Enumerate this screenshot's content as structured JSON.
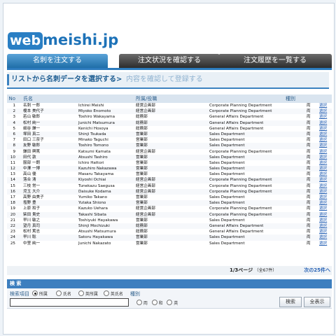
{
  "logo": {
    "web": "web",
    "rest": "meishi.jp"
  },
  "tabs": [
    {
      "label": "名刺を注文する",
      "active": true
    },
    {
      "label": "注文状況を確認する",
      "active": false
    },
    {
      "label": "注文履歴を一覧する",
      "active": false
    }
  ],
  "steps": {
    "current": "リストから名刺データを選択する",
    "arrow": ">",
    "next": "内容を確認して登録する"
  },
  "table": {
    "headers": {
      "no": "No",
      "name": "氏名",
      "dept": "所属/役職",
      "type": "種別"
    },
    "select_label": "選択",
    "rows": [
      {
        "no": "1",
        "name": "名刺 一郎",
        "roman": "Ichirei Meishi",
        "dept": "経営企画部",
        "eng": "Corporate Planning Department",
        "type": "両"
      },
      {
        "no": "2",
        "name": "榎本 美代子",
        "roman": "Miyoko Enomoto",
        "dept": "経営企画部",
        "eng": "Corporate Planning Department",
        "type": "両"
      },
      {
        "no": "3",
        "name": "若山 敏郎",
        "roman": "Toshiro Wakayama",
        "dept": "総務部",
        "eng": "General Affairs Department",
        "type": "両"
      },
      {
        "no": "4",
        "name": "松村 純一",
        "roman": "Junichi Matsumura",
        "dept": "総務部",
        "eng": "General Affairs Department",
        "type": "両"
      },
      {
        "no": "5",
        "name": "細谷 謙一",
        "roman": "Kenichi Hosoya",
        "dept": "総務部",
        "eng": "General Affairs Department",
        "type": "両"
      },
      {
        "no": "6",
        "name": "塚田 真二",
        "roman": "Shinji Tsukada",
        "dept": "営業部",
        "eng": "Sales Department",
        "type": "両"
      },
      {
        "no": "7",
        "name": "田口 三奈子",
        "roman": "Minako Taguchi",
        "dept": "営業部",
        "eng": "Sales Department",
        "type": "両"
      },
      {
        "no": "8",
        "name": "友野 敏郎",
        "roman": "Toshiro Tomono",
        "dept": "営業部",
        "eng": "Sales Department",
        "type": "両"
      },
      {
        "no": "9",
        "name": "鎌田 興篤",
        "roman": "Katsumi Kamata",
        "dept": "経営企画部",
        "eng": "Corporate Planning Department",
        "type": "両"
      },
      {
        "no": "10",
        "name": "田代 敦",
        "roman": "Atsushi Tashiro",
        "dept": "営業部",
        "eng": "Sales Department",
        "type": "両"
      },
      {
        "no": "11",
        "name": "服部 一朗",
        "roman": "Ichiro Hattori",
        "dept": "営業部",
        "eng": "Sales Department",
        "type": "両"
      },
      {
        "no": "12",
        "name": "中澤 一博",
        "roman": "Kazuhiro Nakazawa",
        "dept": "営業部",
        "eng": "Sales Department",
        "type": "両"
      },
      {
        "no": "13",
        "name": "高山 優",
        "roman": "Masaru Takayama",
        "dept": "営業部",
        "eng": "Sales Department",
        "type": "両"
      },
      {
        "no": "14",
        "name": "落合 清",
        "roman": "Kiyoshi Ochiai",
        "dept": "経営企画部",
        "eng": "Corporate Planning Department",
        "type": "両"
      },
      {
        "no": "15",
        "name": "三枝 常一",
        "roman": "Tunekazu Saegusa",
        "dept": "経営企画部",
        "eng": "Corporate Planning Department",
        "type": "両"
      },
      {
        "no": "16",
        "name": "児玉 大介",
        "roman": "Daisuke Kodama",
        "dept": "経営企画部",
        "eng": "Corporate Planning Department",
        "type": "両"
      },
      {
        "no": "17",
        "name": "高野 由美子",
        "roman": "Yumiko Takano",
        "dept": "営業部",
        "eng": "Sales Department",
        "type": "両"
      },
      {
        "no": "18",
        "name": "塩野 豊",
        "roman": "Yutaka Shiono",
        "dept": "営業部",
        "eng": "Sales Department",
        "type": "両"
      },
      {
        "no": "19",
        "name": "上原 和子",
        "roman": "Kazuko Uehara",
        "dept": "経営企画部",
        "eng": "Corporate Planning Department",
        "type": "両"
      },
      {
        "no": "20",
        "name": "柴田 貴史",
        "roman": "Takashi Sibata",
        "dept": "経営企画部",
        "eng": "Corporate Planning Department",
        "type": "両"
      },
      {
        "no": "21",
        "name": "早川 敏之",
        "roman": "Toshiyuki Hayakawa",
        "dept": "営業部",
        "eng": "Sales Department",
        "type": "両"
      },
      {
        "no": "22",
        "name": "望月 真司",
        "roman": "Shinji Mochizuki",
        "dept": "総務部",
        "eng": "General Affairs Department",
        "type": "両"
      },
      {
        "no": "23",
        "name": "松村 篤志",
        "roman": "Atsushi Matsumura",
        "dept": "総務部",
        "eng": "General Affairs Department",
        "type": "両"
      },
      {
        "no": "24",
        "name": "早川 聡",
        "roman": "Satoru Hayakawa",
        "dept": "営業部",
        "eng": "Sales Department",
        "type": "両"
      },
      {
        "no": "25",
        "name": "中里 純一",
        "roman": "Junichi Nakazato",
        "dept": "営業部",
        "eng": "Sales Department",
        "type": "両"
      }
    ]
  },
  "pager": {
    "info": "1/3ページ",
    "total": "（全67件）",
    "next": "次の25件へ"
  },
  "search": {
    "title": "検 索",
    "item_label": "検索項目",
    "item_options": [
      {
        "label": "所属",
        "checked": true
      },
      {
        "label": "氏名",
        "checked": false
      },
      {
        "label": "英所属",
        "checked": false
      },
      {
        "label": "英氏名",
        "checked": false
      }
    ],
    "type_label": "種別",
    "type_options": [
      {
        "label": "両",
        "checked": false
      },
      {
        "label": "和",
        "checked": false
      },
      {
        "label": "英",
        "checked": false
      }
    ],
    "input_value": "",
    "search_button": "検索",
    "show_all_button": "全表示"
  },
  "colors": {
    "accent": "#2c7bbd",
    "link": "#2a64b6",
    "tab_dark": "#2c2c2c"
  }
}
